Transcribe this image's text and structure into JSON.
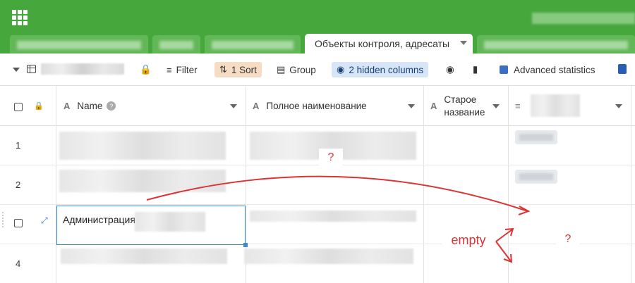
{
  "header": {
    "active_tab_label": "Объекты контроля, адресаты"
  },
  "toolbar": {
    "filter_label": "Filter",
    "sort_label": "1 Sort",
    "group_label": "Group",
    "hidden_columns_label": "2 hidden columns",
    "advanced_statistics_label": "Advanced statistics"
  },
  "columns": [
    {
      "label": "Name",
      "type_icon": "text-type-icon"
    },
    {
      "label": "Полное наименование",
      "type_icon": "text-type-icon"
    },
    {
      "label": "Старое название",
      "type_icon": "text-type-icon"
    }
  ],
  "rows": [
    {
      "number": "1"
    },
    {
      "number": "2"
    },
    {
      "name": "Администрация"
    },
    {
      "number": "4"
    }
  ],
  "annotations": {
    "question_mark": "?",
    "empty_label": "empty",
    "color": "#dd3333"
  },
  "colors": {
    "brand_green": "#46a73c",
    "selection_blue": "#3b8ad9",
    "sort_badge": "#f6dcc3",
    "hidden_badge": "#d7e5f8"
  }
}
